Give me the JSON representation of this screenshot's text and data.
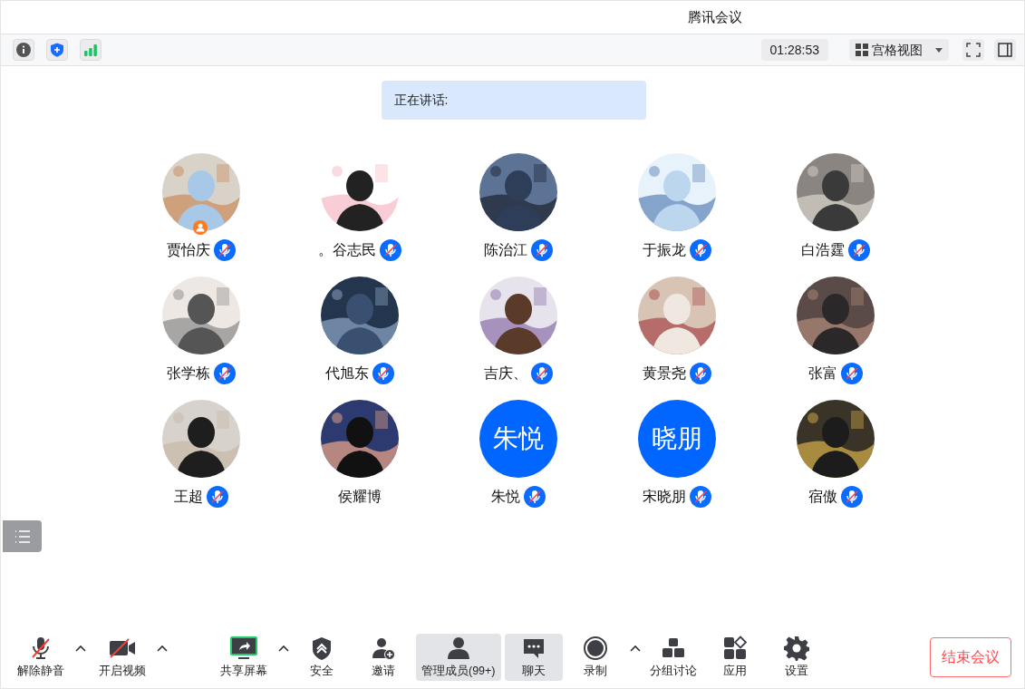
{
  "window": {
    "title": "腾讯会议"
  },
  "top_bar": {
    "timer": "01:28:53",
    "view": "宫格视图"
  },
  "speaking": {
    "label": "正在讲话:"
  },
  "participants": [
    {
      "name": "贾怡庆",
      "muted": true,
      "host": true
    },
    {
      "name": "。谷志民",
      "muted": true,
      "host": false
    },
    {
      "name": "陈治江",
      "muted": true,
      "host": false
    },
    {
      "name": "于振龙",
      "muted": true,
      "host": false
    },
    {
      "name": "白浩霆",
      "muted": true,
      "host": false
    },
    {
      "name": "张学栋",
      "muted": true,
      "host": false
    },
    {
      "name": "代旭东",
      "muted": true,
      "host": false
    },
    {
      "name": "吉庆、",
      "muted": true,
      "host": false
    },
    {
      "name": "黄景尧",
      "muted": true,
      "host": false
    },
    {
      "name": "张富",
      "muted": true,
      "host": false
    },
    {
      "name": "王超",
      "muted": true,
      "host": false
    },
    {
      "name": "侯耀博",
      "muted": false,
      "host": false
    },
    {
      "name": "朱悦",
      "avatar": {
        "kind": "initials",
        "text": "朱悦"
      },
      "muted": true,
      "host": false
    },
    {
      "name": "宋晓朋",
      "avatar": {
        "kind": "initials",
        "text": "晓朋"
      },
      "muted": true,
      "host": false
    },
    {
      "name": "宿傲",
      "muted": true,
      "host": false
    }
  ],
  "toolbar": [
    {
      "kind": "mic",
      "label": "解除静音",
      "caret": true,
      "selected": false
    },
    {
      "kind": "video",
      "label": "开启视频",
      "caret": true,
      "selected": false
    },
    {
      "kind": "share",
      "label": "共享屏幕",
      "caret": true,
      "selected": false
    },
    {
      "kind": "security",
      "label": "安全",
      "caret": false,
      "selected": false
    },
    {
      "kind": "invite",
      "label": "邀请",
      "caret": false,
      "selected": false
    },
    {
      "kind": "members",
      "label": "管理成员(99+)",
      "caret": false,
      "selected": true
    },
    {
      "kind": "chat",
      "label": "聊天",
      "caret": false,
      "selected": true
    },
    {
      "kind": "record",
      "label": "录制",
      "caret": true,
      "selected": false
    },
    {
      "kind": "breakout",
      "label": "分组讨论",
      "caret": false,
      "selected": false
    },
    {
      "kind": "apps",
      "label": "应用",
      "caret": false,
      "selected": false
    },
    {
      "kind": "settings",
      "label": "设置",
      "caret": false,
      "selected": false
    }
  ],
  "end_button": "结束会议"
}
